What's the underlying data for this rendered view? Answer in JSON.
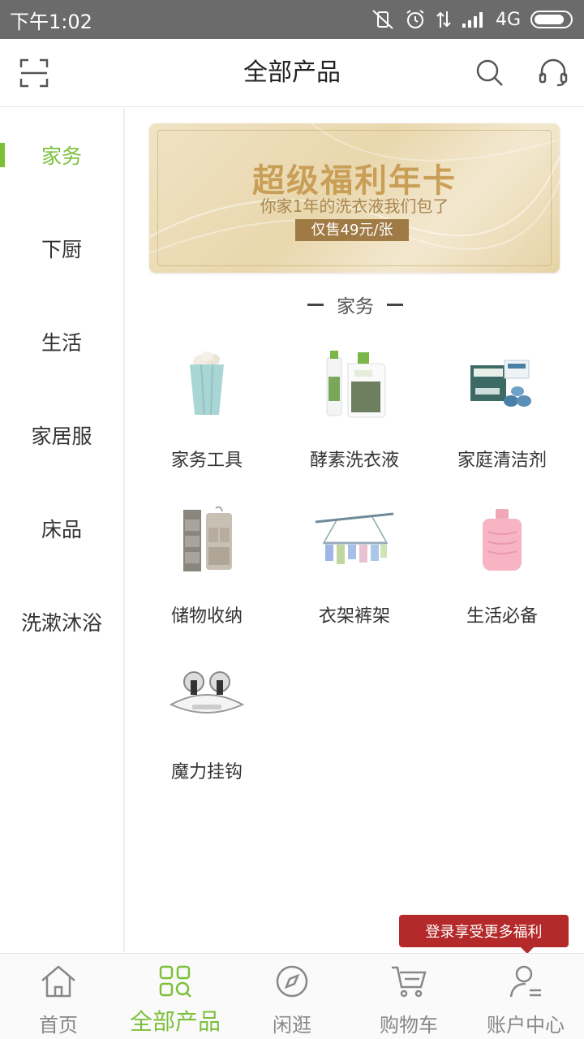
{
  "status_bar": {
    "time": "下午1:02",
    "network": "4G",
    "battery_level": 0.85
  },
  "header": {
    "title": "全部产品",
    "icons": [
      "scan-icon",
      "search-icon",
      "headset-icon"
    ]
  },
  "sidebar": {
    "items": [
      {
        "label": "家务",
        "active": true
      },
      {
        "label": "下厨",
        "active": false
      },
      {
        "label": "生活",
        "active": false
      },
      {
        "label": "家居服",
        "active": false
      },
      {
        "label": "床品",
        "active": false
      },
      {
        "label": "洗漱沐浴",
        "active": false
      }
    ]
  },
  "banner": {
    "title": "超级福利年卡",
    "subtitle": "你家1年的洗衣液我们包了",
    "price_tag": "仅售49元/张"
  },
  "section": {
    "title": "家务"
  },
  "products": [
    {
      "label": "家务工具",
      "icon": "paper-bin-icon"
    },
    {
      "label": "酵素洗衣液",
      "icon": "detergent-icon"
    },
    {
      "label": "家庭清洁剂",
      "icon": "cleaner-box-icon"
    },
    {
      "label": "储物收纳",
      "icon": "hanging-organizer-icon"
    },
    {
      "label": "衣架裤架",
      "icon": "drying-rack-icon"
    },
    {
      "label": "生活必备",
      "icon": "hot-water-bottle-icon"
    },
    {
      "label": "魔力挂钩",
      "icon": "suction-hook-icon"
    }
  ],
  "tooltip": {
    "text": "登录享受更多福利"
  },
  "tabbar": {
    "tabs": [
      {
        "label": "首页",
        "icon": "home-icon",
        "active": false
      },
      {
        "label": "全部产品",
        "icon": "grid-search-icon",
        "active": true
      },
      {
        "label": "闲逛",
        "icon": "compass-icon",
        "active": false
      },
      {
        "label": "购物车",
        "icon": "cart-icon",
        "active": false
      },
      {
        "label": "账户中心",
        "icon": "user-icon",
        "active": false
      }
    ]
  },
  "colors": {
    "accent": "#7cc03a",
    "tooltip": "#b42a2a",
    "status_bar": "#6b6b6b"
  }
}
